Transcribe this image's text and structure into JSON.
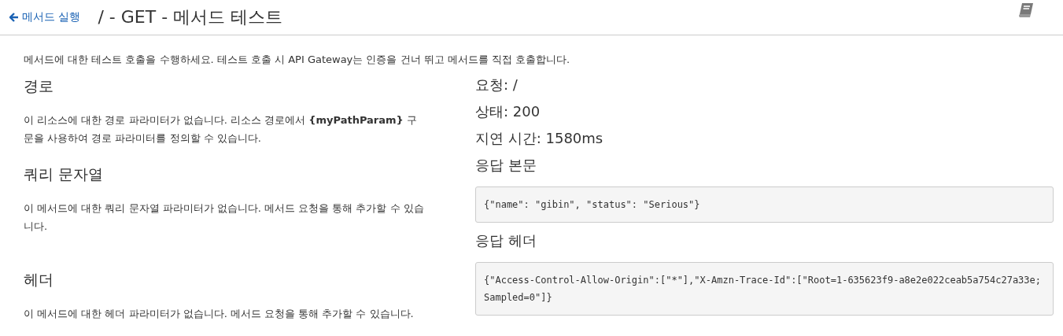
{
  "header": {
    "back_link": "메서드 실행",
    "title": "/ - GET - 메서드 테스트"
  },
  "intro": "메서드에 대한 테스트 호출을 수행하세요. 테스트 호출 시 API Gateway는 인증을 건너 뛰고 메서드를 직접 호출합니다.",
  "sections": [
    {
      "heading": "경로",
      "text": "이 리소스에 대한 경로 파라미터가 없습니다. 리소스 경로에서 **{myPathParam}** 구문을 사용하여 경로 파라미터를 정의할 수 있습니다."
    },
    {
      "heading": "쿼리 문자열",
      "text": "이 메서드에 대한 쿼리 문자열 파라미터가 없습니다. 메서드 요청을 통해 추가할 수 있습니다."
    },
    {
      "heading": "헤더",
      "text": "이 메서드에 대한 헤더 파라미터가 없습니다. 메서드 요청을 통해 추가할 수 있습니다."
    }
  ],
  "result": {
    "lines": [
      "요청: /",
      "상태: 200",
      "지연 시간: 1580ms"
    ],
    "blocks": [
      {
        "heading": "응답 본문",
        "code": "{\"name\": \"gibin\", \"status\": \"Serious\"}"
      },
      {
        "heading": "응답 헤더",
        "code": "{\"Access-Control-Allow-Origin\":[\"*\"],\"X-Amzn-Trace-Id\":[\"Root=1-635623f9-a8e2e022ceab5a754c27a33e;Sampled=0\"]}"
      }
    ]
  }
}
